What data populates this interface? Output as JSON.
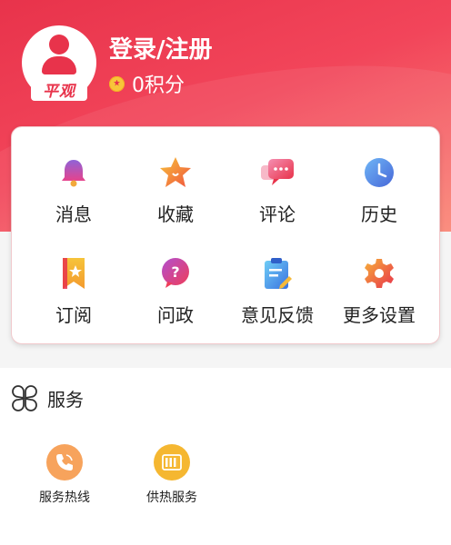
{
  "user": {
    "login_label": "登录/注册",
    "points_label": "0积分",
    "avatar_logo": "平观"
  },
  "menu": {
    "items": [
      {
        "label": "消息",
        "icon": "bell-icon"
      },
      {
        "label": "收藏",
        "icon": "star-icon"
      },
      {
        "label": "评论",
        "icon": "comment-icon"
      },
      {
        "label": "历史",
        "icon": "clock-icon"
      },
      {
        "label": "订阅",
        "icon": "bookmark-icon"
      },
      {
        "label": "问政",
        "icon": "question-icon"
      },
      {
        "label": "意见反馈",
        "icon": "feedback-icon"
      },
      {
        "label": "更多设置",
        "icon": "gear-icon"
      }
    ]
  },
  "services": {
    "title": "服务",
    "items": [
      {
        "label": "服务热线",
        "icon": "phone-icon"
      },
      {
        "label": "供热服务",
        "icon": "heating-icon"
      }
    ]
  },
  "colors": {
    "brand_red": "#e8334b",
    "accent_orange": "#f7a35c",
    "accent_yellow": "#f5b731"
  }
}
